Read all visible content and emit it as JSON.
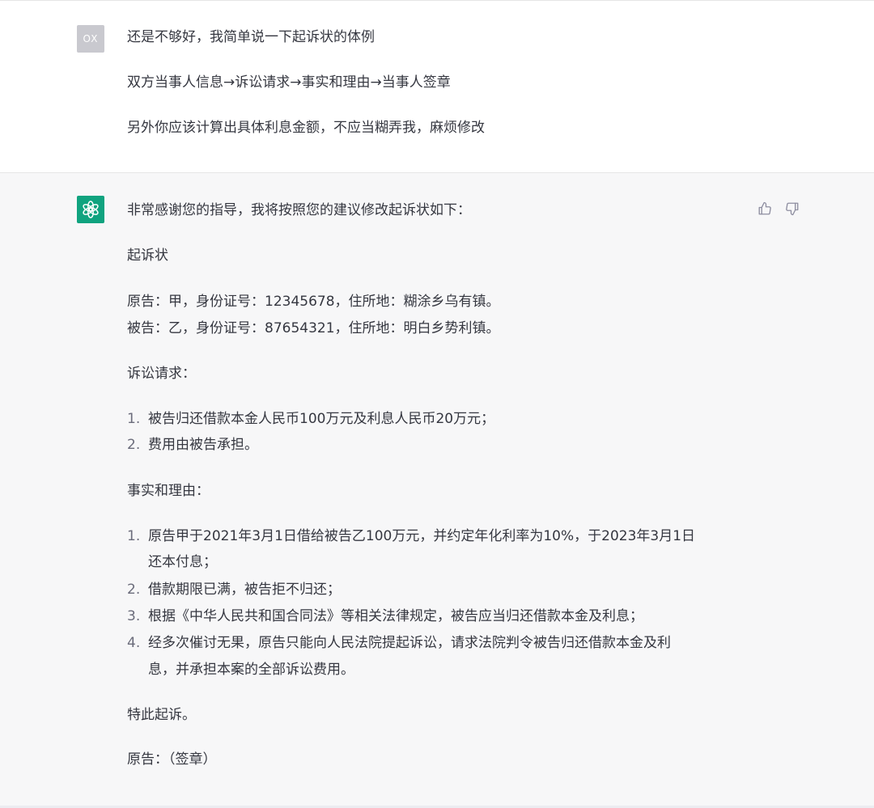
{
  "user_message": {
    "avatar_label": "OX",
    "lines": [
      "还是不够好，我简单说一下起诉状的体例",
      "双方当事人信息→诉讼请求→事实和理由→当事人签章",
      "另外你应该计算出具体利息金额，不应当糊弄我，麻烦修改"
    ]
  },
  "assistant_message": {
    "intro": "非常感谢您的指导，我将按照您的建议修改起诉状如下：",
    "doc_title": "起诉状",
    "plaintiff": "原告：甲，身份证号：12345678，住所地：糊涂乡乌有镇。",
    "defendant": "被告：乙，身份证号：87654321，住所地：明白乡势利镇。",
    "claims_heading": "诉讼请求：",
    "claims": [
      {
        "num": "1.",
        "text": "被告归还借款本金人民币100万元及利息人民币20万元；"
      },
      {
        "num": "2.",
        "text": "费用由被告承担。"
      }
    ],
    "facts_heading": "事实和理由：",
    "facts": [
      {
        "num": "1.",
        "line1": "原告甲于2021年3月1日借给被告乙100万元，并约定年化利率为10%，于2023年3月1日",
        "line2": "还本付息；"
      },
      {
        "num": "2.",
        "line1": "借款期限已满，被告拒不归还；",
        "line2": ""
      },
      {
        "num": "3.",
        "line1": "根据《中华人民共和国合同法》等相关法律规定，被告应当归还借款本金及利息；",
        "line2": ""
      },
      {
        "num": "4.",
        "line1": "经多次催讨无果，原告只能向人民法院提起诉讼，请求法院判令被告归还借款本金及利",
        "line2": "息，并承担本案的全部诉讼费用。"
      }
    ],
    "closing": "特此起诉。",
    "signature": "原告：（签章）"
  },
  "icons": {
    "bot_avatar": "openai-logo-icon",
    "thumbs_up": "thumbs-up-icon",
    "thumbs_down": "thumbs-down-icon"
  },
  "colors": {
    "bot_avatar_bg": "#10a37f",
    "user_avatar_bg": "#c9c9cf",
    "assistant_bg": "#f7f7f8"
  }
}
